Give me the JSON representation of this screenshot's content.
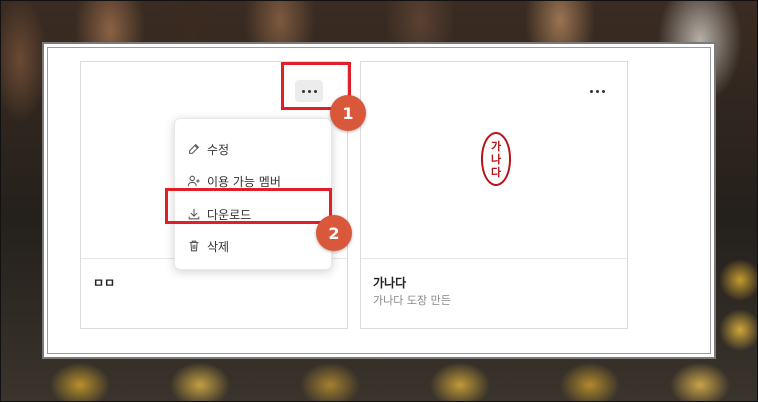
{
  "cards": [
    {
      "title": "ㅁㅁ",
      "subtitle": ""
    },
    {
      "title": "가나다",
      "subtitle": "가나다 도장 만든",
      "seal_chars": [
        "가",
        "나",
        "다"
      ]
    }
  ],
  "menu": {
    "items": [
      {
        "label": "수정",
        "icon": "edit-icon"
      },
      {
        "label": "이용 가능 멤버",
        "icon": "add-member-icon"
      },
      {
        "label": "다운로드",
        "icon": "download-icon"
      },
      {
        "label": "삭제",
        "icon": "trash-icon"
      }
    ]
  },
  "annotations": {
    "step1": "1",
    "step2": "2"
  },
  "colors": {
    "highlight": "#e01f26",
    "badge": "#d9573b",
    "seal": "#b4141a"
  }
}
